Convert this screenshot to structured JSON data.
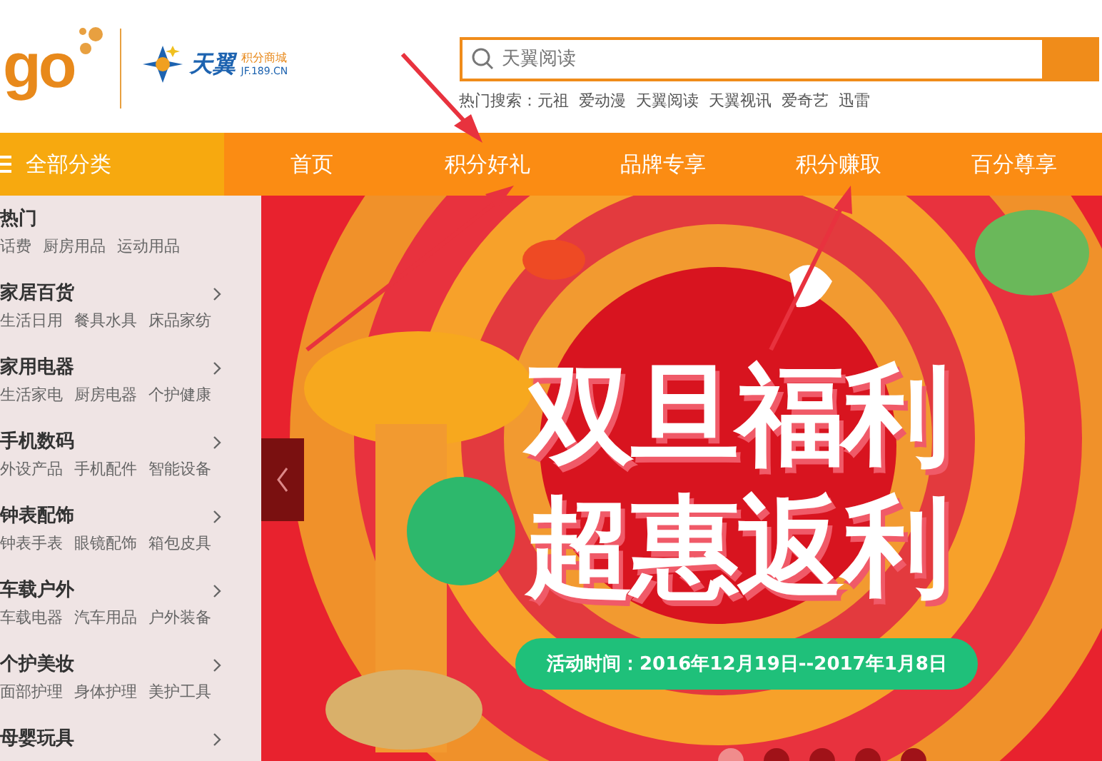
{
  "header": {
    "logo": "go",
    "partner_logo": {
      "name": "天翼",
      "tagline": "积分商城",
      "domain": "JF.189.CN"
    },
    "search": {
      "placeholder": "天翼阅读"
    },
    "hot_search": {
      "label": "热门搜索：",
      "terms": [
        "元祖",
        "爱动漫",
        "天翼阅读",
        "天翼视讯",
        "爱奇艺",
        "迅雷"
      ]
    }
  },
  "nav": {
    "all_categories": "全部分类",
    "items": [
      {
        "label": "首页",
        "selected": false
      },
      {
        "label": "积分好礼",
        "selected": false
      },
      {
        "label": "品牌专享",
        "selected": false
      },
      {
        "label": "积分赚取",
        "selected": false
      },
      {
        "label": "百分尊享",
        "selected": false
      }
    ]
  },
  "sidebar": {
    "categories": [
      {
        "name": "热门",
        "expandable": false,
        "links": [
          "话费",
          "厨房用品",
          "运动用品"
        ]
      },
      {
        "name": "家居百货",
        "expandable": true,
        "links": [
          "生活日用",
          "餐具水具",
          "床品家纺"
        ]
      },
      {
        "name": "家用电器",
        "expandable": true,
        "links": [
          "生活家电",
          "厨房电器",
          "个护健康"
        ]
      },
      {
        "name": "手机数码",
        "expandable": true,
        "links": [
          "外设产品",
          "手机配件",
          "智能设备"
        ]
      },
      {
        "name": "钟表配饰",
        "expandable": true,
        "links": [
          "钟表手表",
          "眼镜配饰",
          "箱包皮具"
        ]
      },
      {
        "name": "车载户外",
        "expandable": true,
        "links": [
          "车载电器",
          "汽车用品",
          "户外装备"
        ]
      },
      {
        "name": "个护美妆",
        "expandable": true,
        "links": [
          "面部护理",
          "身体护理",
          "美护工具"
        ]
      },
      {
        "name": "母婴玩具",
        "expandable": true
      }
    ]
  },
  "banner": {
    "title_lines": [
      "双旦福利",
      "超惠返利"
    ],
    "date": "活动时间：2016年12月19日--2017年1月8日",
    "dots": [
      {
        "selected": true
      },
      {
        "selected": false
      },
      {
        "selected": false
      },
      {
        "selected": false
      },
      {
        "selected": false
      }
    ]
  }
}
